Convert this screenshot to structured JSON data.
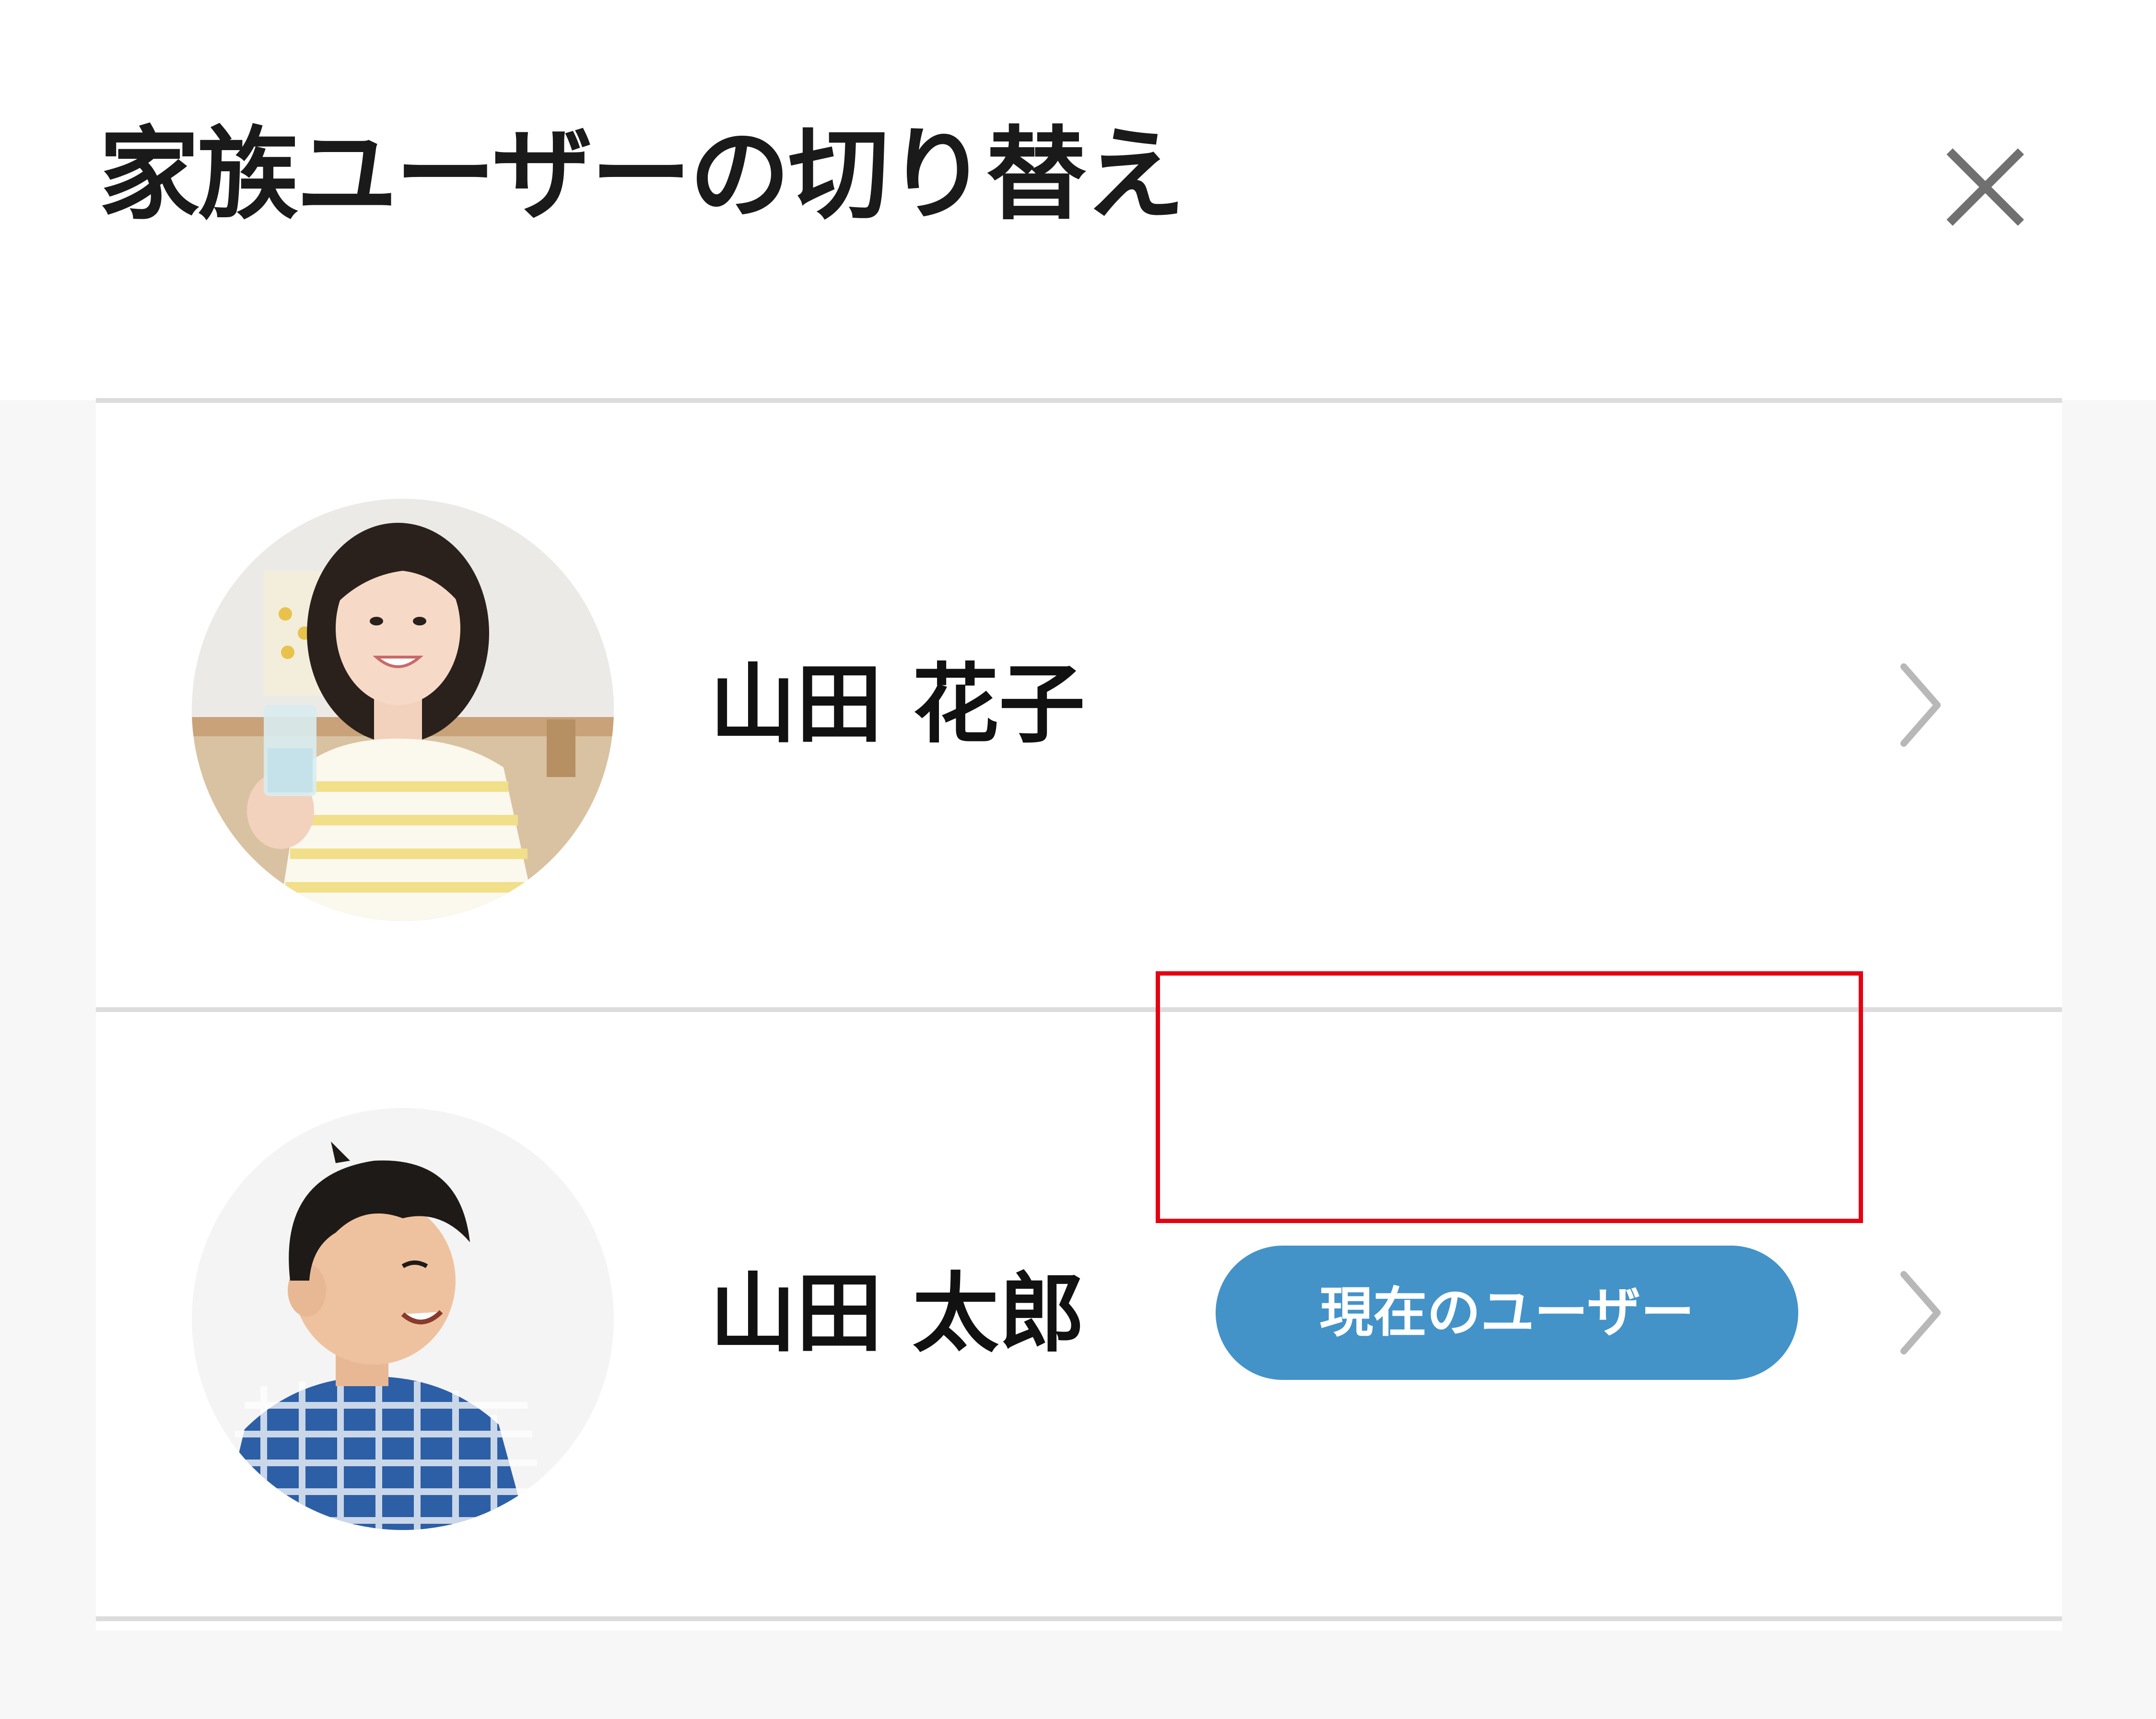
{
  "header": {
    "title": "家族ユーザーの切り替え",
    "close_icon": "close-icon"
  },
  "users": [
    {
      "name": "山田 花子",
      "avatar_icon": "avatar-photo-woman",
      "chevron_icon": "chevron-right-icon"
    },
    {
      "name": "山田 太郎",
      "badge": "現在のユーザー",
      "avatar_icon": "avatar-photo-boy",
      "chevron_icon": "chevron-right-icon"
    }
  ],
  "colors": {
    "badge_background": "#4393c9",
    "highlight_border": "#e60012",
    "divider": "#dcdcdc",
    "chevron": "#b8b8b8"
  }
}
